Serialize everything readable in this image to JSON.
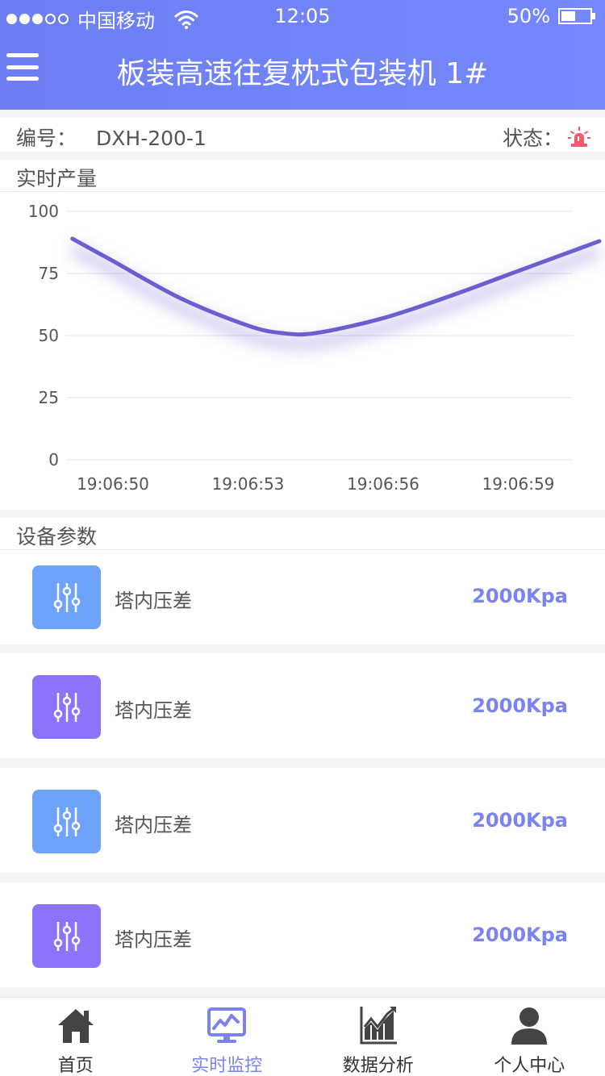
{
  "status_bar": {
    "carrier": "中国移动",
    "time": "12:05",
    "battery": "50%",
    "battery_level": 0.5
  },
  "header": {
    "title": "板装高速往复枕式包装机 1#"
  },
  "info": {
    "code_label": "编号：",
    "code_value": "DXH-200-1",
    "status_label": "状态：",
    "status_icon": "alarm-icon",
    "status_color": "#f45b69"
  },
  "chart": {
    "section_title": "实时产量"
  },
  "chart_data": {
    "type": "line",
    "title": "实时产量",
    "x": [
      "19:06:50",
      "19:06:53",
      "19:06:56",
      "19:06:59"
    ],
    "yticks": [
      0,
      25,
      50,
      75,
      100
    ],
    "ylim": [
      0,
      100
    ],
    "series": [
      {
        "color": "#6a5fd1",
        "points": [
          [
            -0.3,
            89
          ],
          [
            0,
            80
          ],
          [
            0.5,
            65
          ],
          [
            1,
            54
          ],
          [
            1.25,
            51
          ],
          [
            1.5,
            51
          ],
          [
            2,
            57
          ],
          [
            2.5,
            66
          ],
          [
            3,
            76
          ],
          [
            3.3,
            82
          ],
          [
            3.6,
            88
          ]
        ]
      }
    ],
    "grid": true
  },
  "params": {
    "section_title": "设备参数",
    "items": [
      {
        "label": "塔内压差",
        "value": "2000Kpa",
        "color": "#6fa2fb",
        "icon": "sliders-icon"
      },
      {
        "label": "塔内压差",
        "value": "2000Kpa",
        "color": "#8c73fa",
        "icon": "sliders-icon"
      },
      {
        "label": "塔内压差",
        "value": "2000Kpa",
        "color": "#6fa2fb",
        "icon": "sliders-icon"
      },
      {
        "label": "塔内压差",
        "value": "2000Kpa",
        "color": "#8c73fa",
        "icon": "sliders-icon"
      }
    ]
  },
  "tabbar": {
    "items": [
      {
        "label": "首页",
        "icon": "home-icon",
        "active": false
      },
      {
        "label": "实时监控",
        "icon": "monitor-icon",
        "active": true
      },
      {
        "label": "数据分析",
        "icon": "chart-icon",
        "active": false
      },
      {
        "label": "个人中心",
        "icon": "user-icon",
        "active": false
      }
    ],
    "active_color": "#7a83f0",
    "inactive_color": "#444444"
  }
}
